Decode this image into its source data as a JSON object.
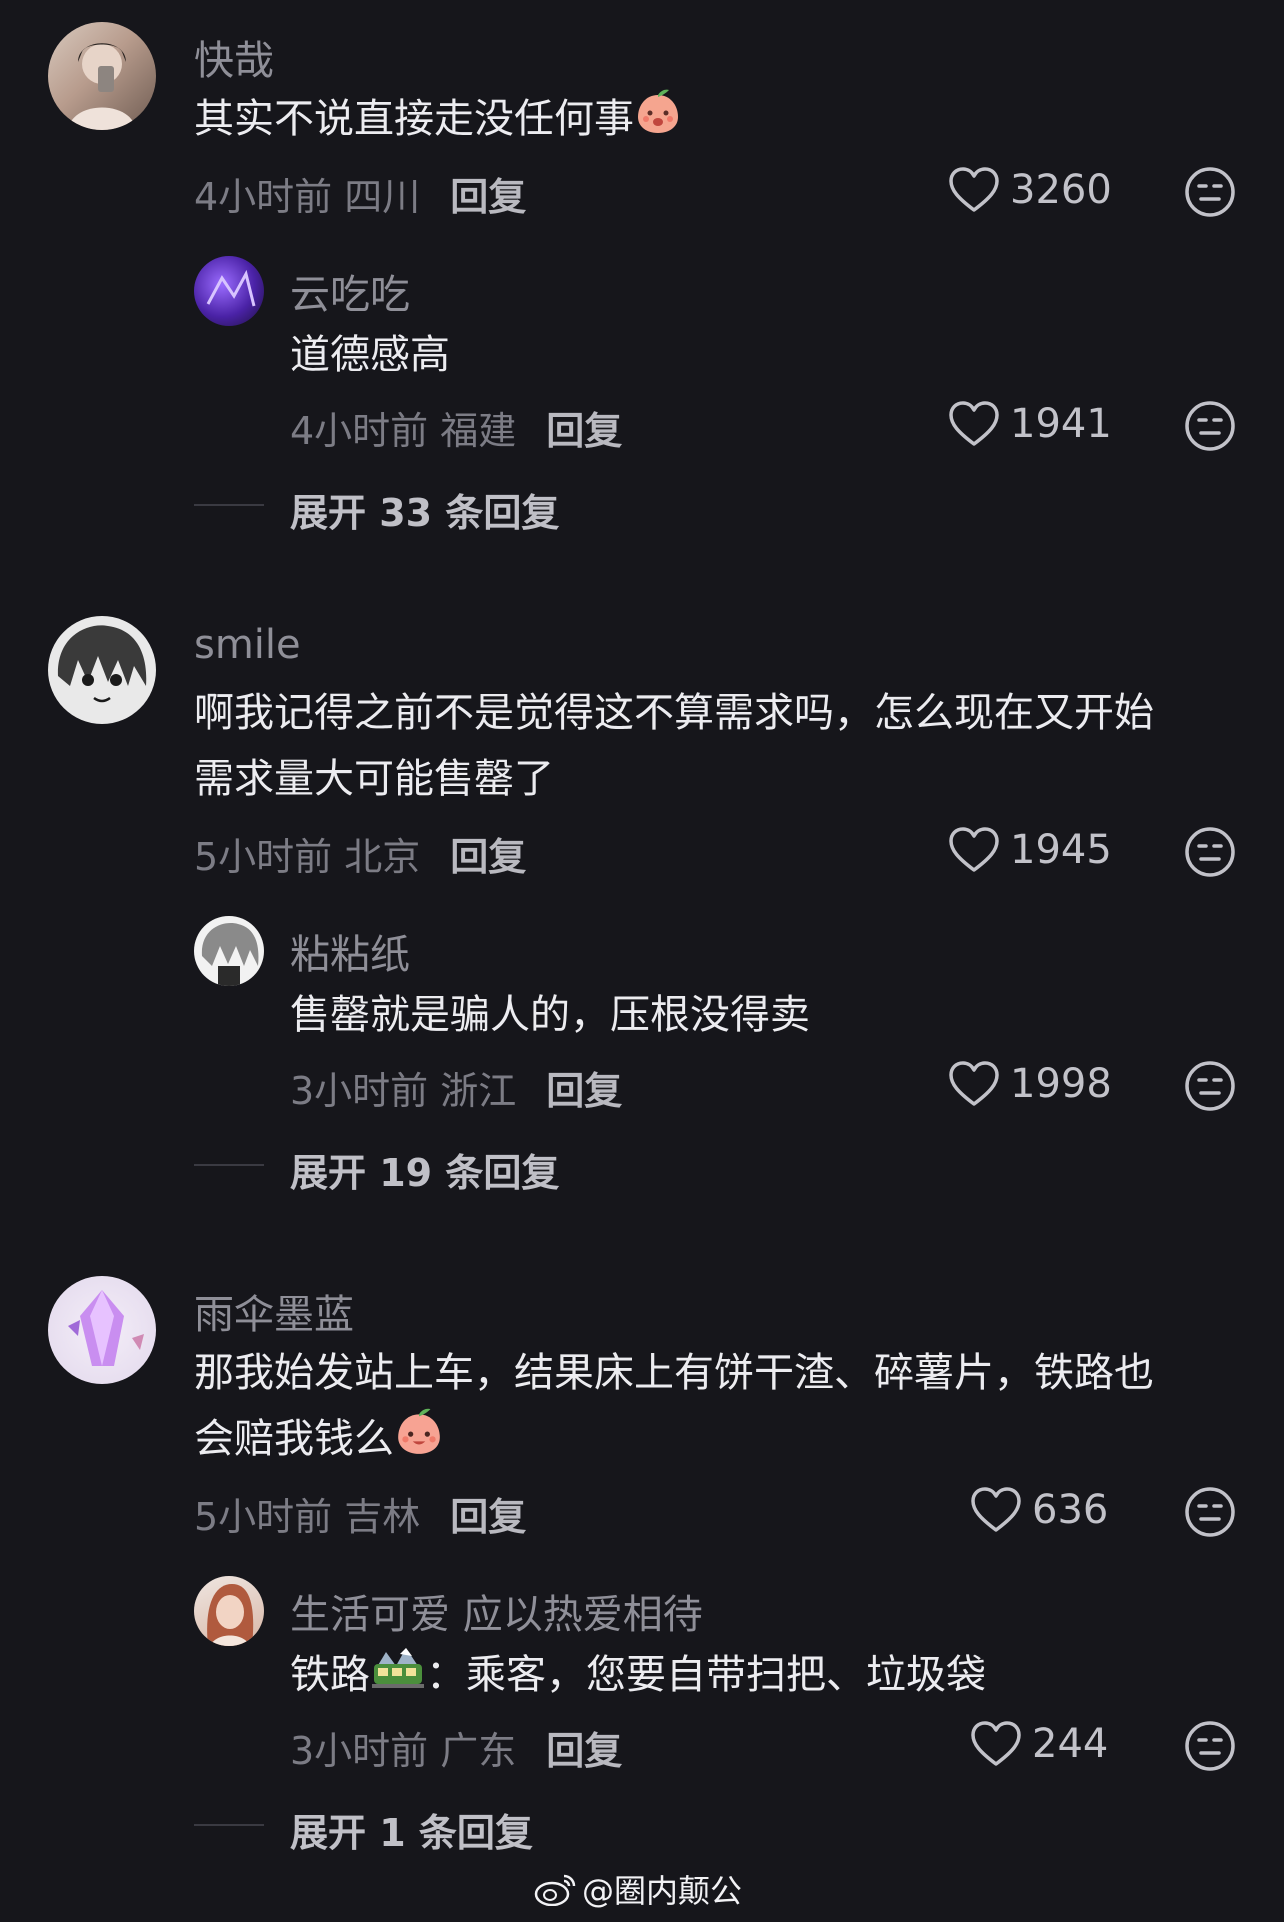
{
  "comments": [
    {
      "user": "快哉",
      "text": "其实不说直接走没任何事",
      "time": "4小时前 四川",
      "reply_label": "回复",
      "likes": "3260",
      "reply": {
        "user": "云吃吃",
        "text": "道德感高",
        "time": "4小时前 福建",
        "reply_label": "回复",
        "likes": "1941"
      },
      "expand": "展开 33 条回复"
    },
    {
      "user": "smile",
      "text_line1": "啊我记得之前不是觉得这不算需求吗，怎么现在又开始",
      "text_line2": "需求量大可能售罄了",
      "time": "5小时前 北京",
      "reply_label": "回复",
      "likes": "1945",
      "reply": {
        "user": "粘粘纸",
        "text": "售罄就是骗人的，压根没得卖",
        "time": "3小时前 浙江",
        "reply_label": "回复",
        "likes": "1998"
      },
      "expand": "展开 19 条回复"
    },
    {
      "user": "雨伞墨蓝",
      "text_line1": "那我始发站上车，结果床上有饼干渣、碎薯片，铁路也",
      "text_line2": "会赔我钱么",
      "time": "5小时前 吉林",
      "reply_label": "回复",
      "likes": "636",
      "reply": {
        "user": "生活可爱 应以热爱相待",
        "text_a": "铁路",
        "text_b": "：乘客，您要自带扫把、垃圾袋",
        "time": "3小时前 广东",
        "reply_label": "回复",
        "likes": "244"
      },
      "expand": "展开 1 条回复"
    }
  ],
  "watermark": "@圈内颠公",
  "icons": {
    "like": "heart-outline-icon",
    "dislike": "meh-face-icon",
    "emoji_1": "peach-pouting-emoji",
    "emoji_2": "peach-smiling-emoji",
    "emoji_3": "train-emoji",
    "watermark": "weibo-logo-icon"
  },
  "colors": {
    "background": "#16161b",
    "username": "#8f8f98",
    "text": "#ececf0",
    "meta": "#7c7c85"
  }
}
